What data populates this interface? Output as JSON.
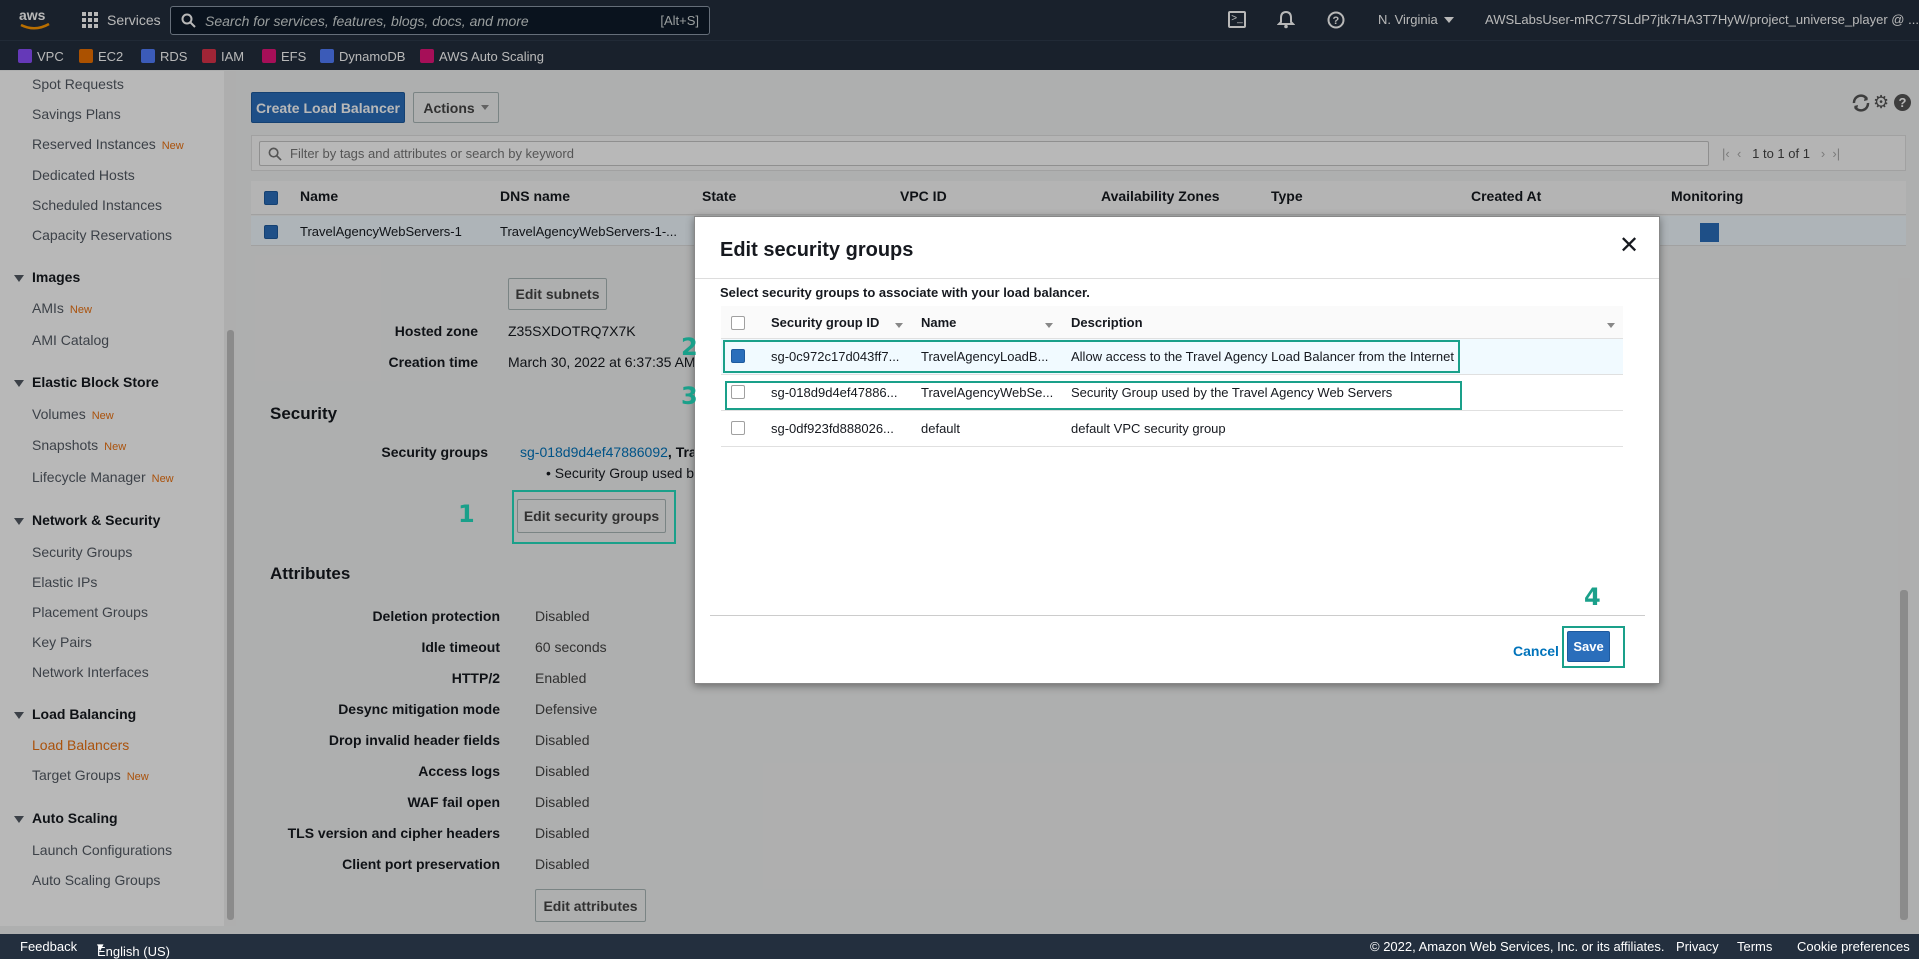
{
  "topnav": {
    "services_label": "Services",
    "search_placeholder": "Search for services, features, blogs, docs, and more",
    "search_shortcut": "[Alt+S]",
    "region": "N. Virginia",
    "account": "AWSLabsUser-mRC77SLdP7jtk7HA3T7HyW/project_universe_player @ ..."
  },
  "favorites": [
    {
      "label": "VPC",
      "color": "#8c4fff"
    },
    {
      "label": "EC2",
      "color": "#ed7100"
    },
    {
      "label": "RDS",
      "color": "#527fff"
    },
    {
      "label": "IAM",
      "color": "#dd344c"
    },
    {
      "label": "EFS",
      "color": "#e7157b"
    },
    {
      "label": "DynamoDB",
      "color": "#527fff"
    },
    {
      "label": "AWS Auto Scaling",
      "color": "#e7157b"
    }
  ],
  "sidebar": {
    "new_tag": "New",
    "items_top": [
      "Spot Requests",
      "Savings Plans",
      "Reserved Instances",
      "Dedicated Hosts",
      "Scheduled Instances",
      "Capacity Reservations"
    ],
    "images_head": "Images",
    "images_items": [
      "AMIs",
      "AMI Catalog"
    ],
    "ebs_head": "Elastic Block Store",
    "ebs_items": [
      "Volumes",
      "Snapshots",
      "Lifecycle Manager"
    ],
    "net_head": "Network & Security",
    "net_items": [
      "Security Groups",
      "Elastic IPs",
      "Placement Groups",
      "Key Pairs",
      "Network Interfaces"
    ],
    "lb_head": "Load Balancing",
    "lb_items": [
      "Load Balancers",
      "Target Groups"
    ],
    "as_head": "Auto Scaling",
    "as_items": [
      "Launch Configurations",
      "Auto Scaling Groups"
    ]
  },
  "toolbar": {
    "create_label": "Create Load Balancer",
    "actions_label": "Actions",
    "filter_placeholder": "Filter by tags and attributes or search by keyword",
    "pagination": "1 to 1 of 1"
  },
  "table": {
    "columns": [
      "Name",
      "DNS name",
      "State",
      "VPC ID",
      "Availability Zones",
      "Type",
      "Created At",
      "Monitoring"
    ],
    "row": {
      "name": "TravelAgencyWebServers-1",
      "dns": "TravelAgencyWebServers-1-..."
    }
  },
  "details": {
    "edit_subnets_label": "Edit subnets",
    "hosted_zone_label": "Hosted zone",
    "hosted_zone_value": "Z35SXDOTRQ7X7K",
    "creation_time_label": "Creation time",
    "creation_time_value": "March 30, 2022 at 6:37:35 AM",
    "security_heading": "Security",
    "security_groups_label": "Security groups",
    "security_groups_link": "sg-018d9d4ef47886092",
    "security_groups_suffix": ", Tra",
    "security_groups_desc": "• Security Group used by",
    "edit_security_groups_label": "Edit security groups",
    "attributes_heading": "Attributes",
    "attributes": [
      {
        "label": "Deletion protection",
        "value": "Disabled"
      },
      {
        "label": "Idle timeout",
        "value": "60 seconds"
      },
      {
        "label": "HTTP/2",
        "value": "Enabled"
      },
      {
        "label": "Desync mitigation mode",
        "value": "Defensive"
      },
      {
        "label": "Drop invalid header fields",
        "value": "Disabled"
      },
      {
        "label": "Access logs",
        "value": "Disabled"
      },
      {
        "label": "WAF fail open",
        "value": "Disabled"
      },
      {
        "label": "TLS version and cipher headers",
        "value": "Disabled"
      },
      {
        "label": "Client port preservation",
        "value": "Disabled"
      }
    ],
    "edit_attributes_label": "Edit attributes"
  },
  "modal": {
    "title": "Edit security groups",
    "instruction": "Select security groups to associate with your load balancer.",
    "columns": [
      "Security group ID",
      "Name",
      "Description"
    ],
    "rows": [
      {
        "id": "sg-0c972c17d043ff7...",
        "name": "TravelAgencyLoadB...",
        "description": "Allow access to the Travel Agency Load Balancer from the Internet",
        "checked": true
      },
      {
        "id": "sg-018d9d4ef47886...",
        "name": "TravelAgencyWebSe...",
        "description": "Security Group used by the Travel Agency Web Servers",
        "checked": false
      },
      {
        "id": "sg-0df923fd888026...",
        "name": "default",
        "description": "default VPC security group",
        "checked": false
      }
    ],
    "cancel_label": "Cancel",
    "save_label": "Save"
  },
  "annotations": [
    "1",
    "2",
    "3",
    "4"
  ],
  "footer": {
    "feedback": "Feedback",
    "language": "English (US)",
    "copyright": "© 2022, Amazon Web Services, Inc. or its affiliates.",
    "privacy": "Privacy",
    "terms": "Terms",
    "cookies": "Cookie preferences"
  }
}
